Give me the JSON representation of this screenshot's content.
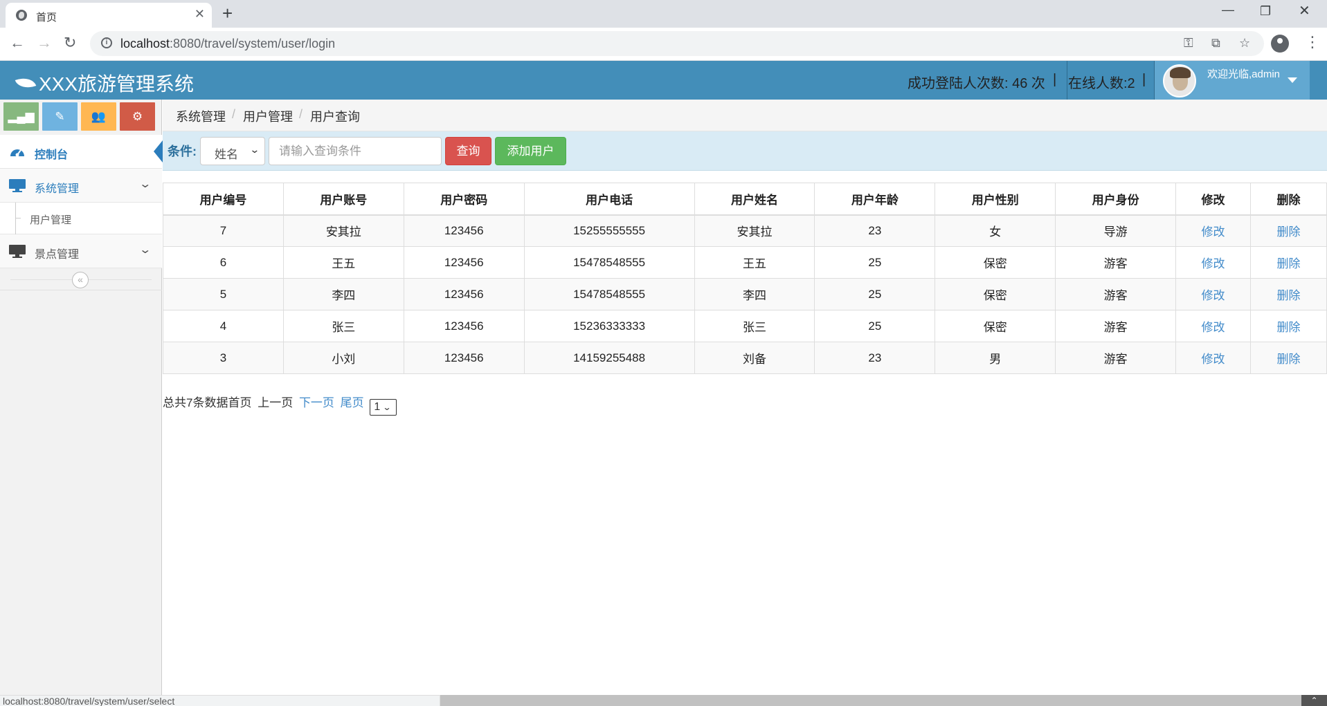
{
  "browser": {
    "tab_title": "首页",
    "url_host": "localhost",
    "url_rest": ":8080/travel/system/user/login",
    "status_url": "localhost:8080/travel/system/user/select"
  },
  "header": {
    "brand": "XXX旅游管理系统",
    "login_count": "成功登陆人次数: 46 次",
    "online_count": "在线人数:2",
    "divider": "|",
    "welcome": "欢迎光临,admin"
  },
  "sidebar": {
    "shortcuts": [
      {
        "icon": "signal-icon",
        "color": "#87b87f"
      },
      {
        "icon": "pencil-icon",
        "color": "#6fb3e0"
      },
      {
        "icon": "users-icon",
        "color": "#ffb752"
      },
      {
        "icon": "cogs-icon",
        "color": "#d15b47"
      }
    ],
    "items": [
      {
        "label": "控制台",
        "icon": "dashboard-icon"
      },
      {
        "label": "系统管理",
        "icon": "desktop-icon"
      },
      {
        "label": "用户管理"
      },
      {
        "label": "景点管理",
        "icon": "desktop-icon"
      }
    ]
  },
  "breadcrumb": [
    "系统管理",
    "用户管理",
    "用户查询"
  ],
  "search": {
    "label": "条件:",
    "field_selected": "姓名",
    "placeholder": "请输入查询条件",
    "query_button": "查询",
    "add_button": "添加用户"
  },
  "table": {
    "headers": [
      "用户编号",
      "用户账号",
      "用户密码",
      "用户电话",
      "用户姓名",
      "用户年龄",
      "用户性别",
      "用户身份",
      "修改",
      "删除"
    ],
    "rows": [
      [
        "7",
        "安其拉",
        "123456",
        "15255555555",
        "安其拉",
        "23",
        "女",
        "导游",
        "修改",
        "删除"
      ],
      [
        "6",
        "王五",
        "123456",
        "15478548555",
        "王五",
        "25",
        "保密",
        "游客",
        "修改",
        "删除"
      ],
      [
        "5",
        "李四",
        "123456",
        "15478548555",
        "李四",
        "25",
        "保密",
        "游客",
        "修改",
        "删除"
      ],
      [
        "4",
        "张三",
        "123456",
        "15236333333",
        "张三",
        "25",
        "保密",
        "游客",
        "修改",
        "删除"
      ],
      [
        "3",
        "小刘",
        "123456",
        "14159255488",
        "刘备",
        "23",
        "男",
        "游客",
        "修改",
        "删除"
      ]
    ]
  },
  "pager": {
    "summary": "总共7条数据",
    "first": "首页",
    "prev": "上一页",
    "next": "下一页",
    "last": "尾页",
    "page": "1"
  }
}
